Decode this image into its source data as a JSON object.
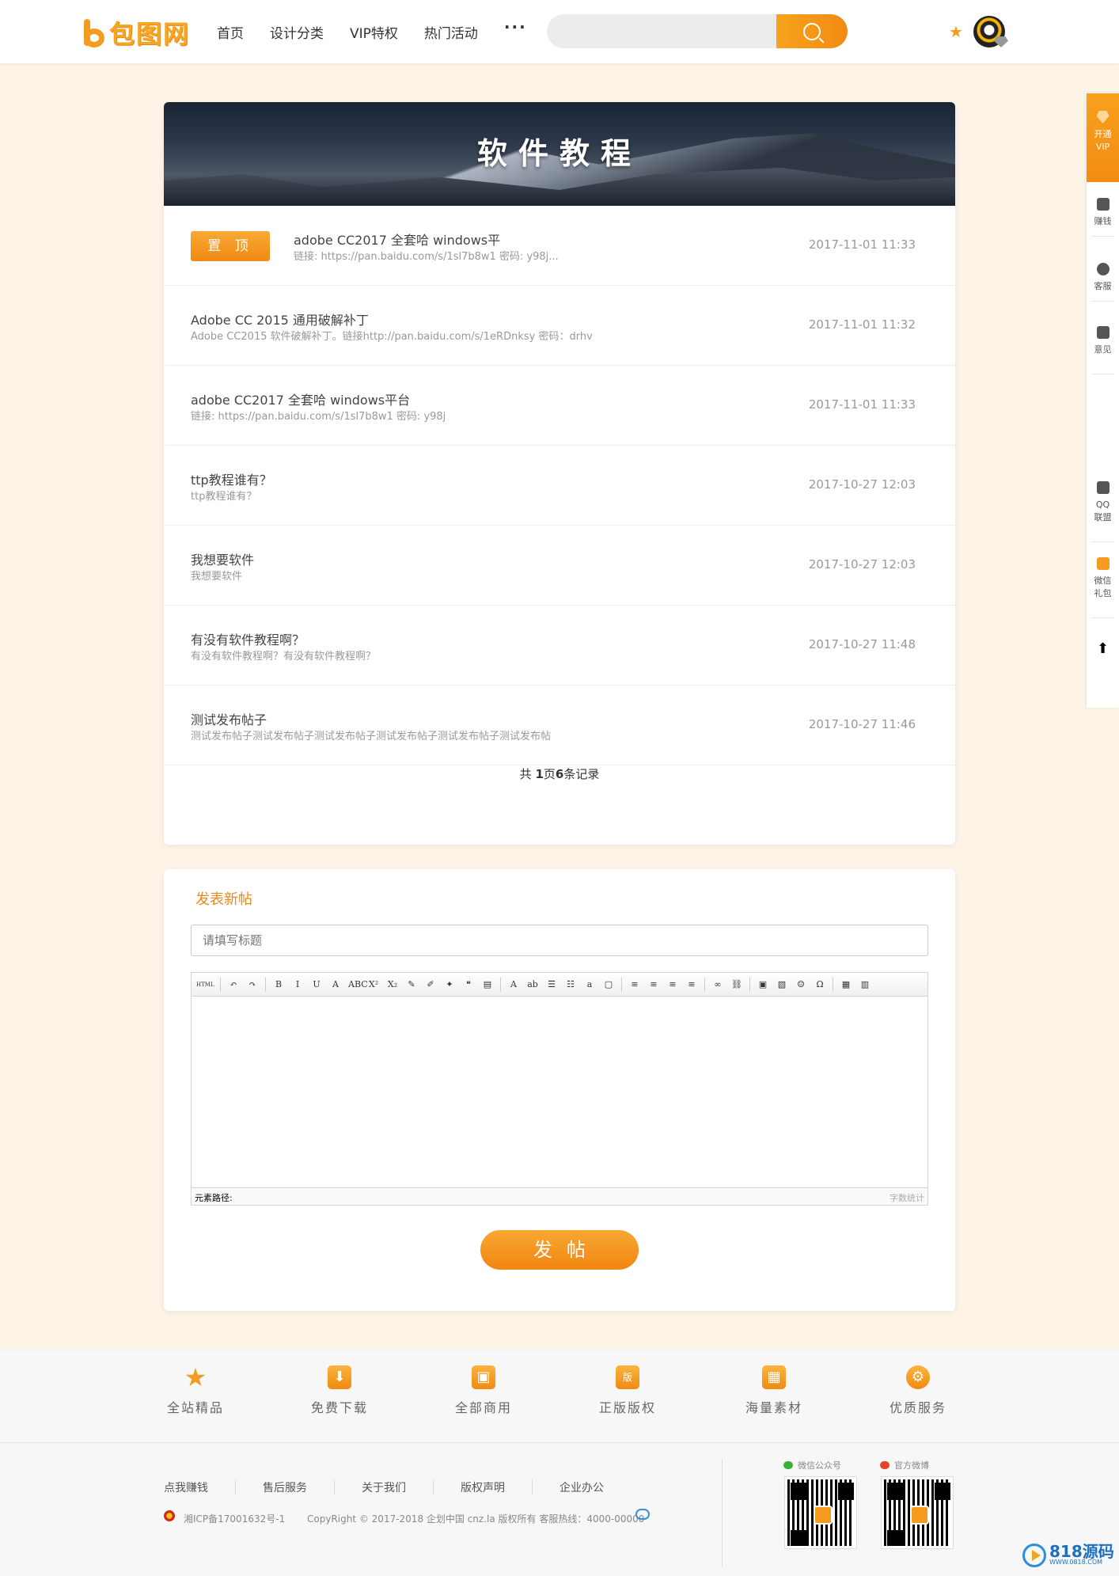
{
  "header": {
    "logo_text": "包图网",
    "nav": [
      "首页",
      "设计分类",
      "VIP特权",
      "热门活动"
    ],
    "nav_more": "···",
    "search_placeholder": ""
  },
  "sidebar": {
    "items": [
      {
        "label": "开通VIP",
        "icon": "vip-diamond-icon"
      },
      {
        "label": "赚钱",
        "icon": "money-icon"
      },
      {
        "label": "客服",
        "icon": "support-icon"
      },
      {
        "label": "意见",
        "icon": "feedback-icon"
      },
      {
        "label": "QQ联盟",
        "icon": "qq-union-icon"
      },
      {
        "label": "微信礼包",
        "icon": "gift-icon"
      },
      {
        "label": "",
        "icon": "back-to-top-icon"
      }
    ]
  },
  "board": {
    "banner_title": "软件教程",
    "pin_label": "置 顶",
    "posts": [
      {
        "title": "adobe CC2017 全套哈 windows平",
        "summary": "链接: https://pan.baidu.com/s/1sl7b8w1 密码: y98j...",
        "date": "2017-11-01 11:33",
        "sticky": true
      },
      {
        "title": "Adobe CC 2015 通用破解补丁",
        "summary": "Adobe CC2015 软件破解补丁。链接http://pan.baidu.com/s/1eRDnksy 密码：drhv",
        "date": "2017-11-01 11:32",
        "sticky": false
      },
      {
        "title": "adobe CC2017 全套哈 windows平台",
        "summary": "链接: https://pan.baidu.com/s/1sl7b8w1 密码: y98j",
        "date": "2017-11-01 11:33",
        "sticky": false
      },
      {
        "title": "ttp教程谁有？",
        "summary": "ttp教程谁有？",
        "date": "2017-10-27 12:03",
        "sticky": false
      },
      {
        "title": "我想要软件",
        "summary": "我想要软件",
        "date": "2017-10-27 12:03",
        "sticky": false
      },
      {
        "title": "有没有软件教程啊？",
        "summary": "有没有软件教程啊？有没有软件教程啊？",
        "date": "2017-10-27 11:48",
        "sticky": false
      },
      {
        "title": "测试发布帖子",
        "summary": "测试发布帖子测试发布帖子测试发布帖子测试发布帖子测试发布帖子测试发布帖",
        "date": "2017-10-27 11:46",
        "sticky": false
      }
    ],
    "pager": {
      "prefix": "共 ",
      "pages": "1",
      "mid": "页",
      "records": "6",
      "suffix": "条记录"
    }
  },
  "compose": {
    "title": "发表新帖",
    "title_placeholder": "请填写标题",
    "editor_path_label": "元素路径:",
    "editor_count_label": "字数统计",
    "submit_label": "发帖",
    "toolbar": [
      "HTML",
      "↶",
      "↷",
      "B",
      "I",
      "U",
      "A",
      "ABC",
      "X²",
      "X₂",
      "✎",
      "✐",
      "✦",
      "❝",
      "▤",
      "A",
      "ab",
      "☰",
      "☷",
      "a",
      "▢",
      "≡",
      "≡",
      "≡",
      "≡",
      "∞",
      "⛓",
      "▣",
      "▧",
      "☺",
      "Ω",
      "▦",
      "▥"
    ]
  },
  "features": [
    "全站精品",
    "免费下载",
    "全部商用",
    "正版版权",
    "海量素材",
    "优质服务"
  ],
  "footer": {
    "links": [
      "点我赚钱",
      "售后服务",
      "关于我们",
      "版权声明",
      "企业办公"
    ],
    "icp": "湘ICP备17001632号-1",
    "copyright": "CopyRight © 2017-2018 企划中国 cnz.la 版权所有 客服热线：4000-00000",
    "qr_wechat_label": "微信公众号",
    "qr_weibo_label": "官方微博"
  },
  "watermark": {
    "text": "818源码",
    "sub": "WWW.0818.COM"
  },
  "colors": {
    "accent": "#f39c1f",
    "accent_dark": "#f08611",
    "bg": "#fdf3e6"
  }
}
